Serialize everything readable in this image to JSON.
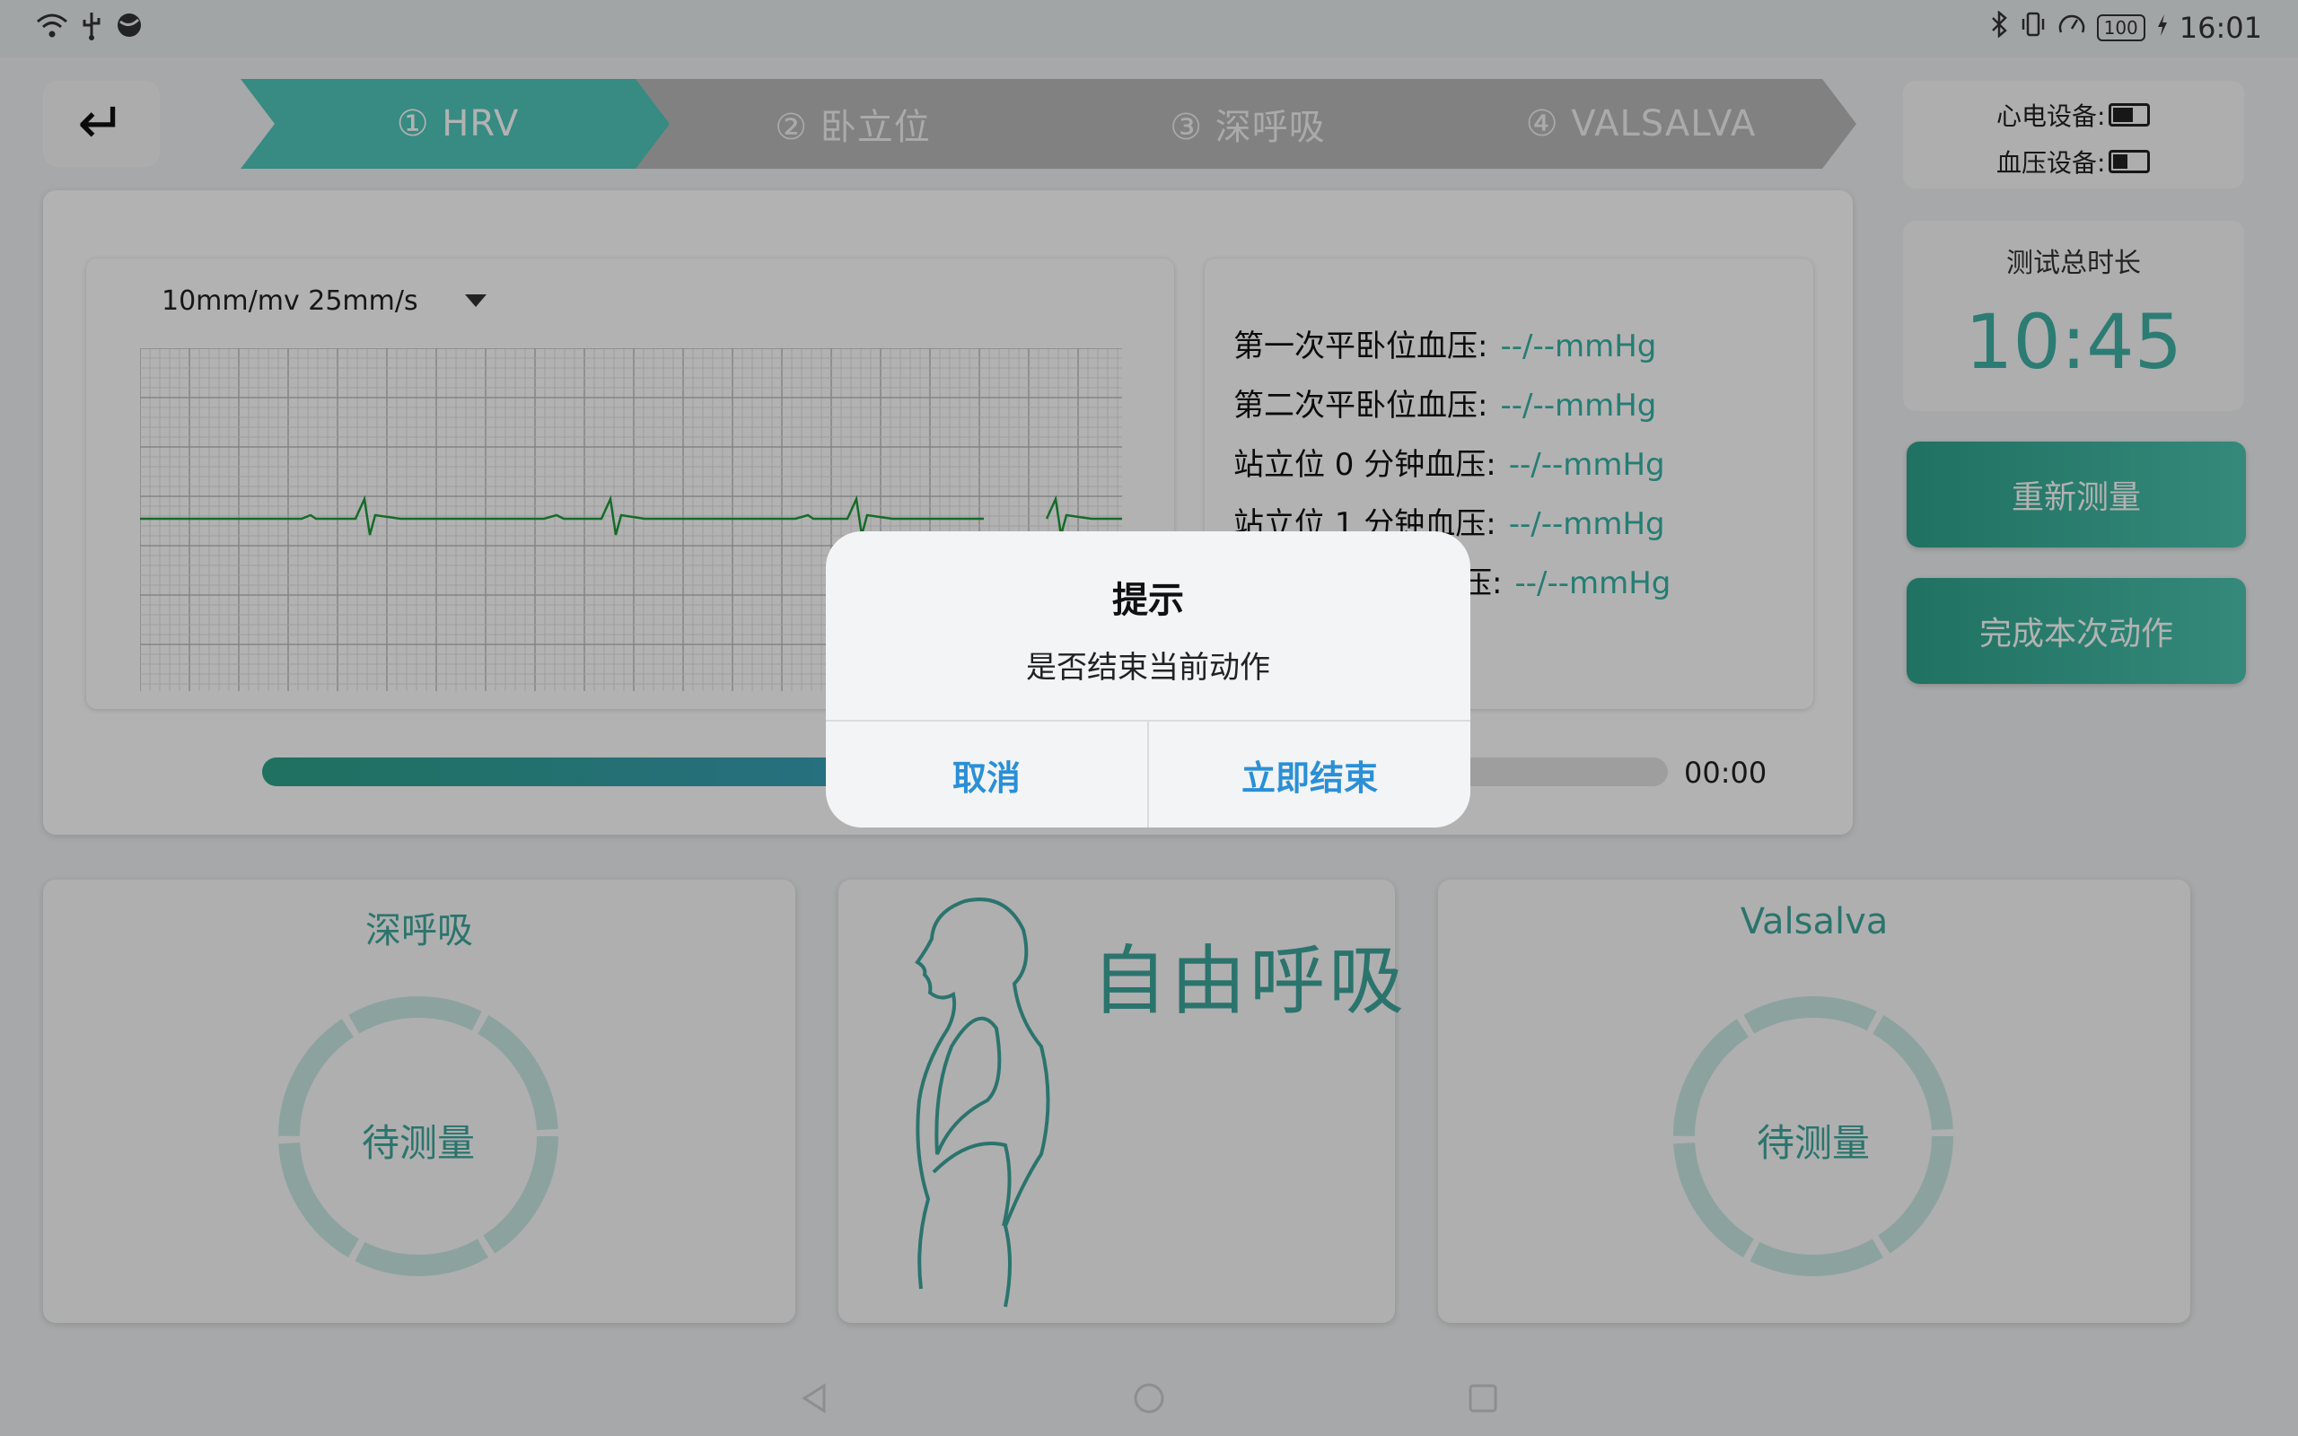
{
  "status_bar": {
    "left_icons": [
      "wifi-icon",
      "usb-icon",
      "vpn-icon"
    ],
    "battery_level": "100",
    "time": "16:01"
  },
  "back_icon": "↵",
  "steps": [
    {
      "label": "① HRV",
      "active": true
    },
    {
      "label": "② 卧立位",
      "active": false
    },
    {
      "label": "③ 深呼吸",
      "active": false
    },
    {
      "label": "④ VALSALVA",
      "active": false
    }
  ],
  "ecg": {
    "scale_option": "10mm/mv 25mm/s"
  },
  "bp_rows": [
    {
      "label": "第一次平卧位血压:",
      "value": "--/--mmHg"
    },
    {
      "label": "第二次平卧位血压:",
      "value": "--/--mmHg"
    },
    {
      "label": "站立位 0 分钟血压:",
      "value": "--/--mmHg"
    },
    {
      "label": "站立位 1 分钟血压:",
      "value": "--/--mmHg"
    },
    {
      "label": "压:",
      "value": "--/--mmHg"
    }
  ],
  "progress": {
    "fraction": 0.5,
    "time": "00:00"
  },
  "devices": {
    "ecg_label": "心电设备:",
    "bp_label": "血压设备:"
  },
  "timer": {
    "label": "测试总时长",
    "value": "10:45"
  },
  "buttons": {
    "remeasure": "重新测量",
    "finish": "完成本次动作"
  },
  "bottom": {
    "deep_breath": {
      "title": "深呼吸",
      "status": "待测量"
    },
    "free_breath": {
      "title": "自由呼吸"
    },
    "valsalva": {
      "title": "Valsalva",
      "status": "待测量"
    }
  },
  "dialog": {
    "title": "提示",
    "message": "是否结束当前动作",
    "cancel": "取消",
    "confirm": "立即结束"
  },
  "colors": {
    "accent": "#4fc7bb",
    "teal_text": "#3ea79c",
    "link_blue": "#2a8fd6"
  }
}
